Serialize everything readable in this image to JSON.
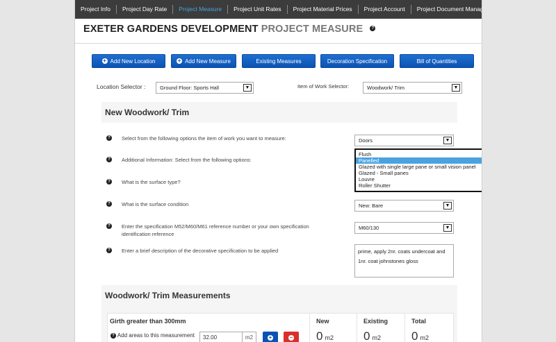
{
  "nav": {
    "tabs": [
      {
        "label": "Project Info"
      },
      {
        "label": "Project Day Rate"
      },
      {
        "label": "Project Measure"
      },
      {
        "label": "Project Unit Rates"
      },
      {
        "label": "Project Material Prices"
      },
      {
        "label": "Project Account"
      },
      {
        "label": "Project Document Manager"
      }
    ],
    "active_index": 2
  },
  "header": {
    "title_main": "EXETER GARDENS DEVELOPMENT",
    "title_sub": "PROJECT MEASURE",
    "help": "?"
  },
  "actions": {
    "add_location": "Add New Location",
    "add_measure": "Add New Measure",
    "existing_measures": "Existing Measures",
    "decoration_spec": "Decoration Specification",
    "bill_of_quantities": "Bill of Quantities"
  },
  "selectors": {
    "location_label": "Location Selector :",
    "location_value": "Ground Floor: Sports Hall",
    "work_label": "Item of Work Selector:",
    "work_value": "Woodwork/ Trim"
  },
  "form": {
    "title": "New Woodwork/ Trim",
    "questions": [
      {
        "text": "Select from the following options the item of work you want to measure:",
        "value": "Doors"
      },
      {
        "text": "Additional Information: Select from the following options:"
      },
      {
        "text": "What is the surface type?"
      },
      {
        "text": "What is the surface condition",
        "value": "New: Bare"
      },
      {
        "text": "Enter the specification M52/M60/M61 reference number or your own specification identification reference",
        "value": "M60/130"
      },
      {
        "text": "Enter a brief description of the decorative specification to be applied",
        "value": "prime, apply 2nr. coats undercoat and 1nr. coat johnstones gloss"
      }
    ],
    "additional_options": [
      "Flush",
      "Panelled",
      "Glazed with single large pane or small vision panel",
      "Glazed - Small panes",
      "Louvre",
      "Roller Shutter"
    ],
    "additional_selected": "Panelled"
  },
  "measurements": {
    "title": "Woodwork/ Trim Measurements",
    "girth_label": "Girth greater than 300mm",
    "add_label": "Add areas to this measurement",
    "input_value": "32.00",
    "unit": "m2",
    "new_label": "New",
    "existing_label": "Existing",
    "total_label": "Total",
    "new_value": "0",
    "existing_value": "0",
    "total_value": "0",
    "plus_symbol": "+",
    "minus_symbol": "−"
  },
  "colors": {
    "nav_bg": "#3c3c3c",
    "nav_active": "#4aa3df",
    "button_blue": "#0b53b3",
    "minus_red": "#d9302c",
    "list_highlight": "#4aa3df"
  }
}
